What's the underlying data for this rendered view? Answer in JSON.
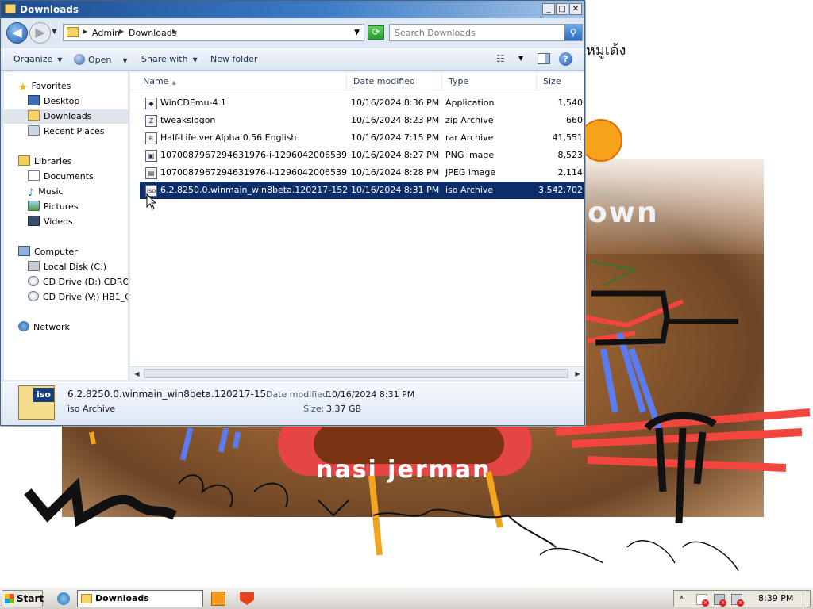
{
  "colors": {
    "title_bar": "#1e4c8e",
    "selection": "#0b2e6a",
    "window_frame": "#dfe9f5",
    "accent_drawing_red": "#f2453d",
    "accent_drawing_blue": "#5b7cf0"
  },
  "window": {
    "title": "Downloads",
    "controls": {
      "minimize": "_",
      "maximize": "□",
      "close": "✕"
    }
  },
  "address": {
    "crumbs": [
      "Admin",
      "Downloads"
    ],
    "search_placeholder": "Search Downloads"
  },
  "toolbar": {
    "organize": "Organize",
    "open": "Open",
    "share_with": "Share with",
    "new_folder": "New folder"
  },
  "nav": {
    "favorites": "Favorites",
    "desktop": "Desktop",
    "downloads": "Downloads",
    "recent_places": "Recent Places",
    "libraries": "Libraries",
    "documents": "Documents",
    "music": "Music",
    "pictures": "Pictures",
    "videos": "Videos",
    "computer": "Computer",
    "local_disk": "Local Disk (C:)",
    "cd_drive_d": "CD Drive (D:) CDROM",
    "cd_drive_v": "CD Drive (V:) HB1_CCF",
    "network": "Network"
  },
  "columns": {
    "name": "Name",
    "date_modified": "Date modified",
    "type": "Type",
    "size": "Size"
  },
  "files": [
    {
      "icon": "installer-icon",
      "glyph": "◆",
      "name": "WinCDEmu-4.1",
      "date": "10/16/2024 8:36 PM",
      "type": "Application",
      "size": "1,540"
    },
    {
      "icon": "zip-icon",
      "glyph": "Z",
      "name": "tweakslogon",
      "date": "10/16/2024 8:23 PM",
      "type": "zip Archive",
      "size": "660"
    },
    {
      "icon": "rar-icon",
      "glyph": "R",
      "name": "Half-Life.ver.Alpha 0.56.English",
      "date": "10/16/2024 7:15 PM",
      "type": "rar Archive",
      "size": "41,551"
    },
    {
      "icon": "png-icon",
      "glyph": "▣",
      "name": "1070087967294631976-i-129604200653927...",
      "date": "10/16/2024 8:27 PM",
      "type": "PNG image",
      "size": "8,523"
    },
    {
      "icon": "jpeg-icon",
      "glyph": "▤",
      "name": "1070087967294631976-i-129604200653927...",
      "date": "10/16/2024 8:28 PM",
      "type": "JPEG image",
      "size": "2,114"
    },
    {
      "icon": "iso-icon",
      "glyph": "iso",
      "name": "6.2.8250.0.winmain_win8beta.120217-1520...",
      "date": "10/16/2024 8:31 PM",
      "type": "iso Archive",
      "size": "3,542,702"
    }
  ],
  "selected_file_index": 5,
  "details": {
    "icon_label": "iso",
    "name": "6.2.8250.0.winmain_win8beta.120217-152...",
    "type": "iso Archive",
    "date_label": "Date modified:",
    "date_value": "10/16/2024 8:31 PM",
    "size_label": "Size:",
    "size_value": "3.37 GB"
  },
  "wallpaper": {
    "caption_top": "own",
    "caption_bottom": "nasi jerman",
    "scribble_text": "หมูเด้ง"
  },
  "taskbar": {
    "start": "Start",
    "active_task": "Downloads",
    "tray_expand": "«",
    "clock": "8:39 PM"
  }
}
